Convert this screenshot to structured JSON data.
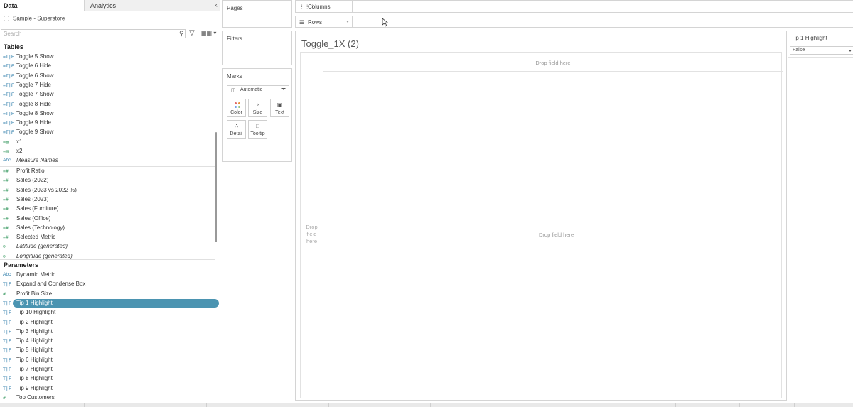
{
  "data_pane": {
    "tab_data": "Data",
    "tab_analytics": "Analytics",
    "collapse_icon": "chevron-left-icon",
    "datasource": "Sample - Superstore",
    "search_placeholder": "Search",
    "tables_title": "Tables",
    "tables": [
      {
        "icon": "calc-string",
        "label": "Toggle 5 Show"
      },
      {
        "icon": "calc-string",
        "label": "Toggle 6 Hide"
      },
      {
        "icon": "calc-string",
        "label": "Toggle 6 Show"
      },
      {
        "icon": "calc-string",
        "label": "Toggle 7 Hide"
      },
      {
        "icon": "calc-string",
        "label": "Toggle 7 Show"
      },
      {
        "icon": "calc-string",
        "label": "Toggle 8 Hide"
      },
      {
        "icon": "calc-string",
        "label": "Toggle 8 Show"
      },
      {
        "icon": "calc-string",
        "label": "Toggle 9 Hide"
      },
      {
        "icon": "calc-string",
        "label": "Toggle 9 Show"
      },
      {
        "icon": "calc-table",
        "label": "x1"
      },
      {
        "icon": "calc-table",
        "label": "x2"
      },
      {
        "icon": "abc",
        "label": "Measure Names"
      }
    ],
    "measures": [
      {
        "icon": "calc-number",
        "label": "Profit Ratio"
      },
      {
        "icon": "calc-number",
        "label": "Sales (2022)"
      },
      {
        "icon": "calc-number",
        "label": "Sales (2023 vs 2022 %)"
      },
      {
        "icon": "calc-number",
        "label": "Sales (2023)"
      },
      {
        "icon": "calc-number",
        "label": "Sales (Furniture)"
      },
      {
        "icon": "calc-number",
        "label": "Sales (Office)"
      },
      {
        "icon": "calc-number",
        "label": "Sales (Technology)"
      },
      {
        "icon": "calc-number",
        "label": "Selected Metric"
      },
      {
        "icon": "globe",
        "label": "Latitude (generated)"
      },
      {
        "icon": "globe",
        "label": "Longitude (generated)"
      }
    ],
    "parameters_title": "Parameters",
    "parameters": [
      {
        "icon": "abc",
        "label": "Dynamic Metric"
      },
      {
        "icon": "boolean",
        "label": "Expand and Condense Box"
      },
      {
        "icon": "number",
        "label": "Profit Bin Size"
      },
      {
        "icon": "boolean",
        "label": "Tip 1 Highlight"
      },
      {
        "icon": "boolean",
        "label": "Tip 10 Highlight"
      },
      {
        "icon": "boolean",
        "label": "Tip 2 Highlight"
      },
      {
        "icon": "boolean",
        "label": "Tip 3 Highlight"
      },
      {
        "icon": "boolean",
        "label": "Tip 4 Highlight"
      },
      {
        "icon": "boolean",
        "label": "Tip 5 Highlight"
      },
      {
        "icon": "boolean",
        "label": "Tip 6 Highlight"
      },
      {
        "icon": "boolean",
        "label": "Tip 7 Highlight"
      },
      {
        "icon": "boolean",
        "label": "Tip 8 Highlight"
      },
      {
        "icon": "boolean",
        "label": "Tip 9 Highlight"
      },
      {
        "icon": "number",
        "label": "Top Customers"
      }
    ],
    "selected_parameter": "Tip 1 Highlight"
  },
  "cards": {
    "pages": "Pages",
    "filters": "Filters",
    "marks": "Marks",
    "mark_type": "Automatic",
    "mark_buttons": [
      {
        "label": "Color",
        "icon": "color-icon"
      },
      {
        "label": "Size",
        "icon": "size-icon"
      },
      {
        "label": "Text",
        "icon": "text-icon"
      },
      {
        "label": "Detail",
        "icon": "detail-icon"
      },
      {
        "label": "Tooltip",
        "icon": "tooltip-icon"
      }
    ]
  },
  "shelves": {
    "columns": "Columns",
    "rows": "Rows"
  },
  "view": {
    "title": "Toggle_1X (2)",
    "col_drop": "Drop field here",
    "row_drop_lines": [
      "Drop",
      "field",
      "here"
    ],
    "body_drop": "Drop field here"
  },
  "parameter_control": {
    "title": "Tip 1 Highlight",
    "value": "False"
  },
  "colors": {
    "selection": "#4b94b1",
    "dimension_icon": "#2a7aa8",
    "measure_icon": "#3a9a62"
  }
}
